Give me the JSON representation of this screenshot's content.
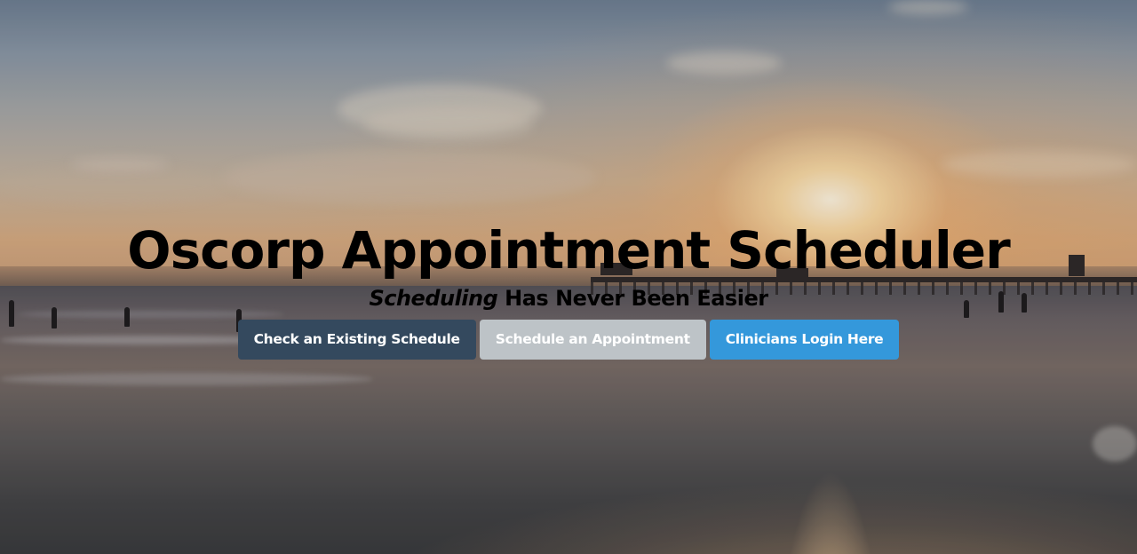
{
  "hero": {
    "title": "Oscorp Appointment Scheduler",
    "subtitle_emphasis": "Scheduling",
    "subtitle_rest": " Has Never Been Easier"
  },
  "buttons": {
    "check_schedule": "Check an Existing Schedule",
    "schedule_appointment": "Schedule an Appointment",
    "clinicians_login": "Clinicians Login Here"
  },
  "colors": {
    "primary": "#34495e",
    "default": "#bdc3c7",
    "info": "#3498db"
  }
}
